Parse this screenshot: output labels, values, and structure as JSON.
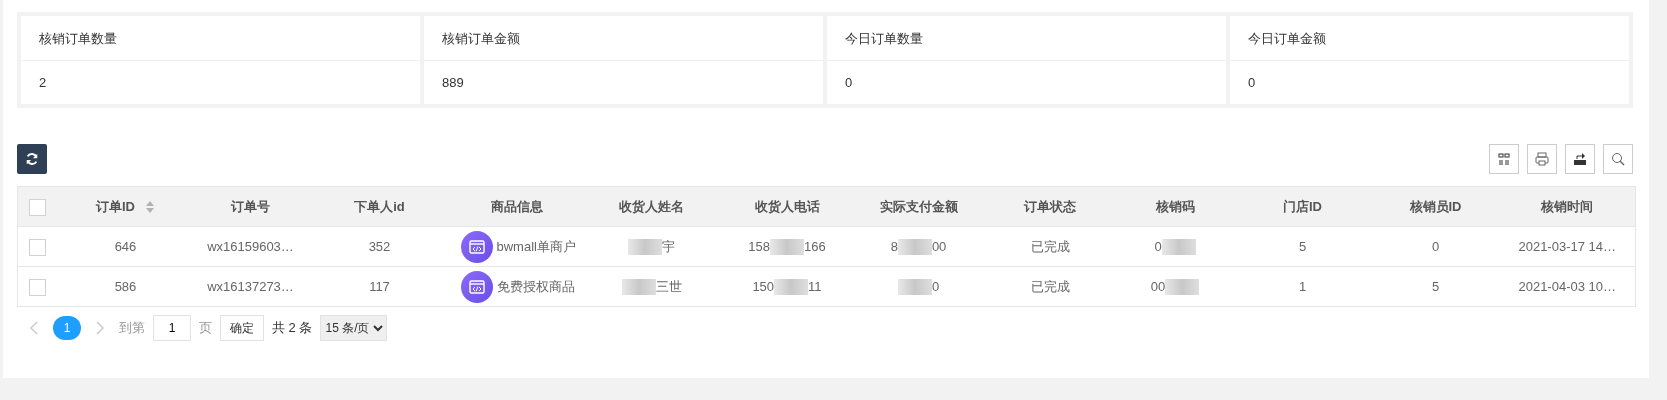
{
  "stats": [
    {
      "label": "核销订单数量",
      "value": "2"
    },
    {
      "label": "核销订单金额",
      "value": "889"
    },
    {
      "label": "今日订单数量",
      "value": "0"
    },
    {
      "label": "今日订单金额",
      "value": "0"
    }
  ],
  "toolbar": {
    "tools": [
      {
        "kind": "columns"
      },
      {
        "kind": "print"
      },
      {
        "kind": "export"
      },
      {
        "kind": "search"
      }
    ]
  },
  "table": {
    "all_checked": false,
    "columns": [
      {
        "label": "订单ID",
        "sortable": true
      },
      {
        "label": "订单号",
        "sortable": false
      },
      {
        "label": "下单人id",
        "sortable": false
      },
      {
        "label": "商品信息",
        "sortable": false
      },
      {
        "label": "收货人姓名",
        "sortable": false
      },
      {
        "label": "收货人电话",
        "sortable": false
      },
      {
        "label": "实际支付金额",
        "sortable": false
      },
      {
        "label": "订单状态",
        "sortable": false
      },
      {
        "label": "核销码",
        "sortable": false
      },
      {
        "label": "门店ID",
        "sortable": false
      },
      {
        "label": "核销员ID",
        "sortable": false
      },
      {
        "label": "核销时间",
        "sortable": false
      }
    ],
    "rows": [
      {
        "checked": false,
        "cells": [
          {
            "text": "646"
          },
          {
            "text": "wx16159603…"
          },
          {
            "text": "352"
          },
          {
            "kind": "product",
            "text": "bwmall单商户"
          },
          {
            "after": "宇"
          },
          {
            "before": "158",
            "after": "166"
          },
          {
            "before": "8",
            "after": "00"
          },
          {
            "text": "已完成"
          },
          {
            "before": "0"
          },
          {
            "text": "5"
          },
          {
            "text": "0"
          },
          {
            "text": "2021-03-17 14…"
          }
        ]
      },
      {
        "checked": false,
        "cells": [
          {
            "text": "586"
          },
          {
            "text": "wx16137273…"
          },
          {
            "text": "117"
          },
          {
            "kind": "product",
            "text": "免费授权商品"
          },
          {
            "after": "三世"
          },
          {
            "before": "150",
            "after": "11"
          },
          {
            "after": "0"
          },
          {
            "text": "已完成"
          },
          {
            "before": "00"
          },
          {
            "text": "1"
          },
          {
            "text": "5"
          },
          {
            "text": "2021-04-03 10…"
          }
        ]
      }
    ]
  },
  "pager": {
    "pages": [
      {
        "label": "1",
        "selected": true
      }
    ],
    "goto_label": "到第",
    "goto_value": "1",
    "page_suffix": "页",
    "confirm": "确定",
    "total": "共 2 条",
    "page_size": "15 条/页"
  }
}
